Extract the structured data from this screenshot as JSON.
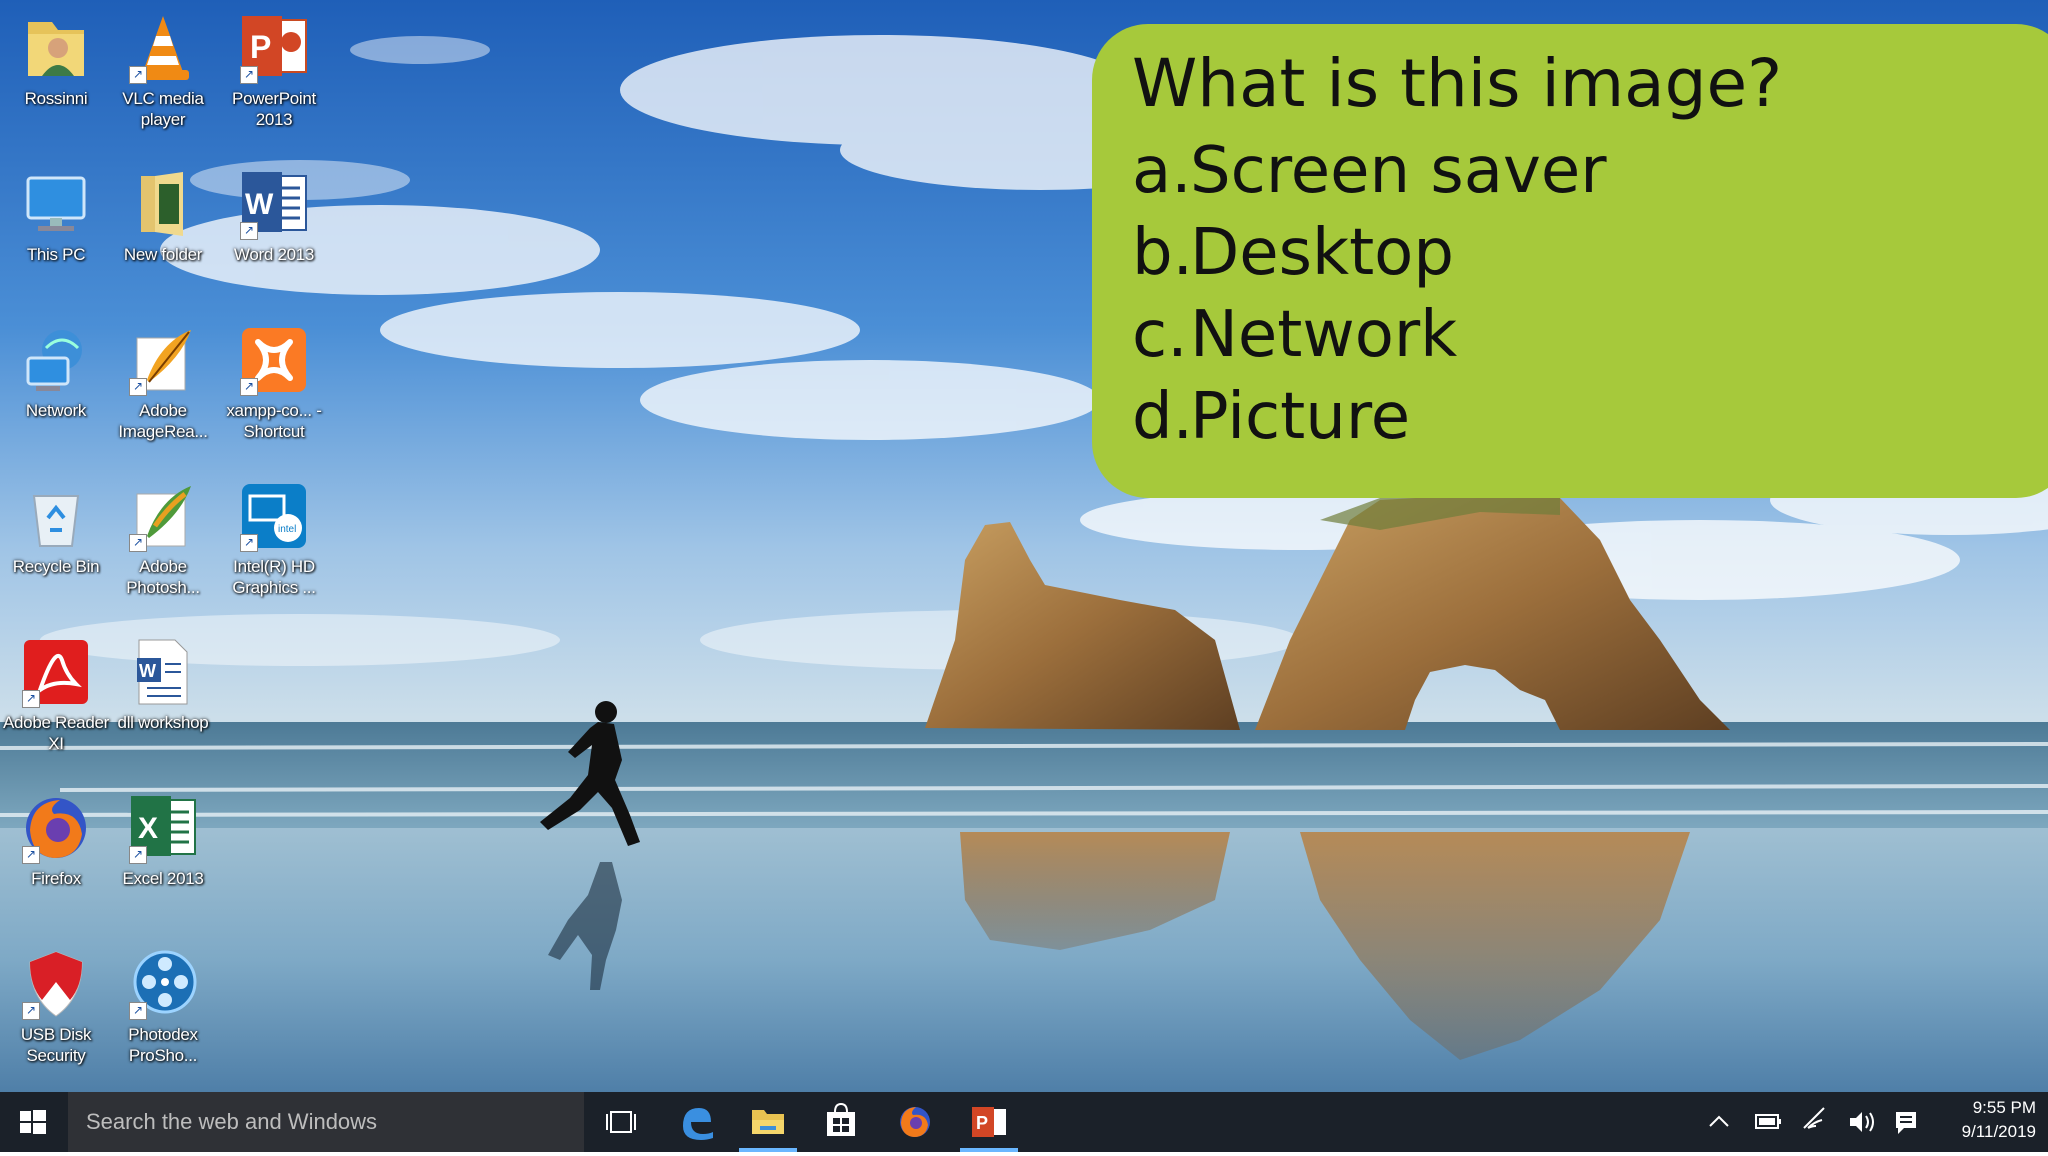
{
  "desktop": {
    "icons": [
      {
        "id": "rossinni",
        "label": "Rossinni",
        "icon": "user-folder-icon"
      },
      {
        "id": "vlc",
        "label": "VLC media player",
        "icon": "vlc-cone-icon"
      },
      {
        "id": "powerpoint",
        "label": "PowerPoint 2013",
        "icon": "powerpoint-icon"
      },
      {
        "id": "thispc",
        "label": "This PC",
        "icon": "computer-icon"
      },
      {
        "id": "newfolder",
        "label": "New folder",
        "icon": "folder-icon"
      },
      {
        "id": "word",
        "label": "Word 2013",
        "icon": "word-icon"
      },
      {
        "id": "network",
        "label": "Network",
        "icon": "network-icon"
      },
      {
        "id": "imageready",
        "label": "Adobe ImageRea...",
        "icon": "feather-icon"
      },
      {
        "id": "xampp",
        "label": "xampp-co... - Shortcut",
        "icon": "xampp-icon"
      },
      {
        "id": "recyclebin",
        "label": "Recycle Bin",
        "icon": "recycle-bin-icon"
      },
      {
        "id": "photoshop",
        "label": "Adobe Photosh...",
        "icon": "feather-icon"
      },
      {
        "id": "intelhd",
        "label": "Intel(R) HD Graphics ...",
        "icon": "intel-graphics-icon"
      },
      {
        "id": "reader",
        "label": "Adobe Reader XI",
        "icon": "pdf-icon"
      },
      {
        "id": "dllworkshop",
        "label": "dll workshop",
        "icon": "word-document-icon"
      },
      {
        "id": "firefox",
        "label": "Firefox",
        "icon": "firefox-icon"
      },
      {
        "id": "excel",
        "label": "Excel 2013",
        "icon": "excel-icon"
      },
      {
        "id": "usbdisk",
        "label": "USB Disk Security",
        "icon": "shield-icon"
      },
      {
        "id": "proshow",
        "label": "Photodex ProSho...",
        "icon": "film-reel-icon"
      }
    ]
  },
  "quiz": {
    "question": "What is this image?",
    "options": [
      {
        "key": "a.",
        "text": "Screen saver"
      },
      {
        "key": "b.",
        "text": "Desktop"
      },
      {
        "key": "c.",
        "text": "Network"
      },
      {
        "key": "d.",
        "text": "Picture"
      }
    ],
    "background": "#a6c93b"
  },
  "taskbar": {
    "search_placeholder": "Search the web and Windows",
    "pinned": [
      {
        "name": "task-view",
        "icon": "task-view-icon"
      },
      {
        "name": "edge",
        "icon": "edge-icon"
      },
      {
        "name": "file-explorer",
        "icon": "folder-icon",
        "active": true
      },
      {
        "name": "store",
        "icon": "store-icon"
      },
      {
        "name": "firefox",
        "icon": "firefox-icon"
      },
      {
        "name": "powerpoint",
        "icon": "powerpoint-icon",
        "active": true
      }
    ],
    "tray": [
      "chevron-up-icon",
      "battery-icon",
      "wifi-icon",
      "volume-icon",
      "notification-icon"
    ],
    "time": "9:55 PM",
    "date": "9/11/2019"
  }
}
